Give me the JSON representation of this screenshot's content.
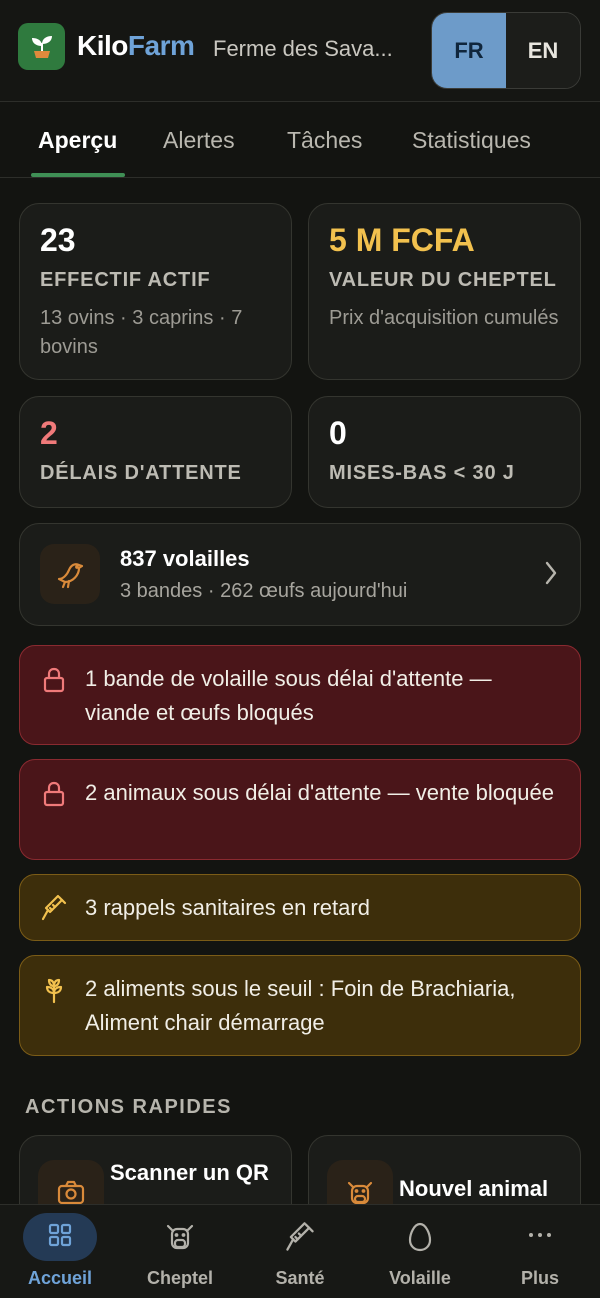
{
  "header": {
    "brand_part1": "Kilo",
    "brand_part2": "Farm",
    "farm_name": "Ferme des Sava...",
    "lang_fr": "FR",
    "lang_en": "EN"
  },
  "tabs": [
    {
      "label": "Aperçu"
    },
    {
      "label": "Alertes"
    },
    {
      "label": "Tâches"
    },
    {
      "label": "Statistiques"
    }
  ],
  "stats": [
    {
      "value": "23",
      "label": "EFFECTIF ACTIF",
      "sub": "13 ovins · 3 caprins · 7 bovins",
      "color": "#ffffff"
    },
    {
      "value": "5 M FCFA",
      "label": "VALEUR DU CHEPTEL",
      "sub": "Prix d'acquisition cumulés",
      "color": "#f2c14e"
    },
    {
      "value": "2",
      "label": "DÉLAIS D'ATTENTE",
      "color": "#f07a7a"
    },
    {
      "value": "0",
      "label": "MISES-BAS < 30 J",
      "color": "#ffffff"
    }
  ],
  "poultry": {
    "title": "837 volailles",
    "subtitle": "3 bandes · 262 œufs aujourd'hui",
    "icon": "bird-icon"
  },
  "alerts": [
    {
      "text": "1 bande de volaille sous délai d'attente — viande et œufs bloqués",
      "icon": "lock-icon",
      "level": "red"
    },
    {
      "text": "2 animaux sous délai d'attente — vente bloquée",
      "icon": "lock-icon",
      "level": "red"
    },
    {
      "text": "3 rappels sanitaires en retard",
      "icon": "syringe-icon",
      "level": "amber"
    },
    {
      "text": "2 aliments sous le seuil : Foin de Brachiaria, Aliment chair démarrage",
      "icon": "wheat-icon",
      "level": "amber"
    }
  ],
  "quick_actions": {
    "title": "ACTIONS RAPIDES",
    "items": [
      {
        "label": "Scanner un QR",
        "icon": "camera-icon"
      },
      {
        "label": "Nouvel animal",
        "icon": "cow-icon"
      }
    ]
  },
  "bottom_nav": [
    {
      "label": "Accueil",
      "icon": "grid-icon",
      "active": true
    },
    {
      "label": "Cheptel",
      "icon": "cow-icon"
    },
    {
      "label": "Santé",
      "icon": "syringe-icon"
    },
    {
      "label": "Volaille",
      "icon": "egg-icon"
    },
    {
      "label": "Plus",
      "icon": "more-icon"
    }
  ],
  "colors": {
    "accent_blue": "#6fa3d8",
    "accent_green": "#3f8f55",
    "alert_red_bg": "#4a1519",
    "alert_amber_bg": "#3d2e0b",
    "alert_red_icon": "#f07a7a",
    "alert_amber_icon": "#f2c14e"
  }
}
